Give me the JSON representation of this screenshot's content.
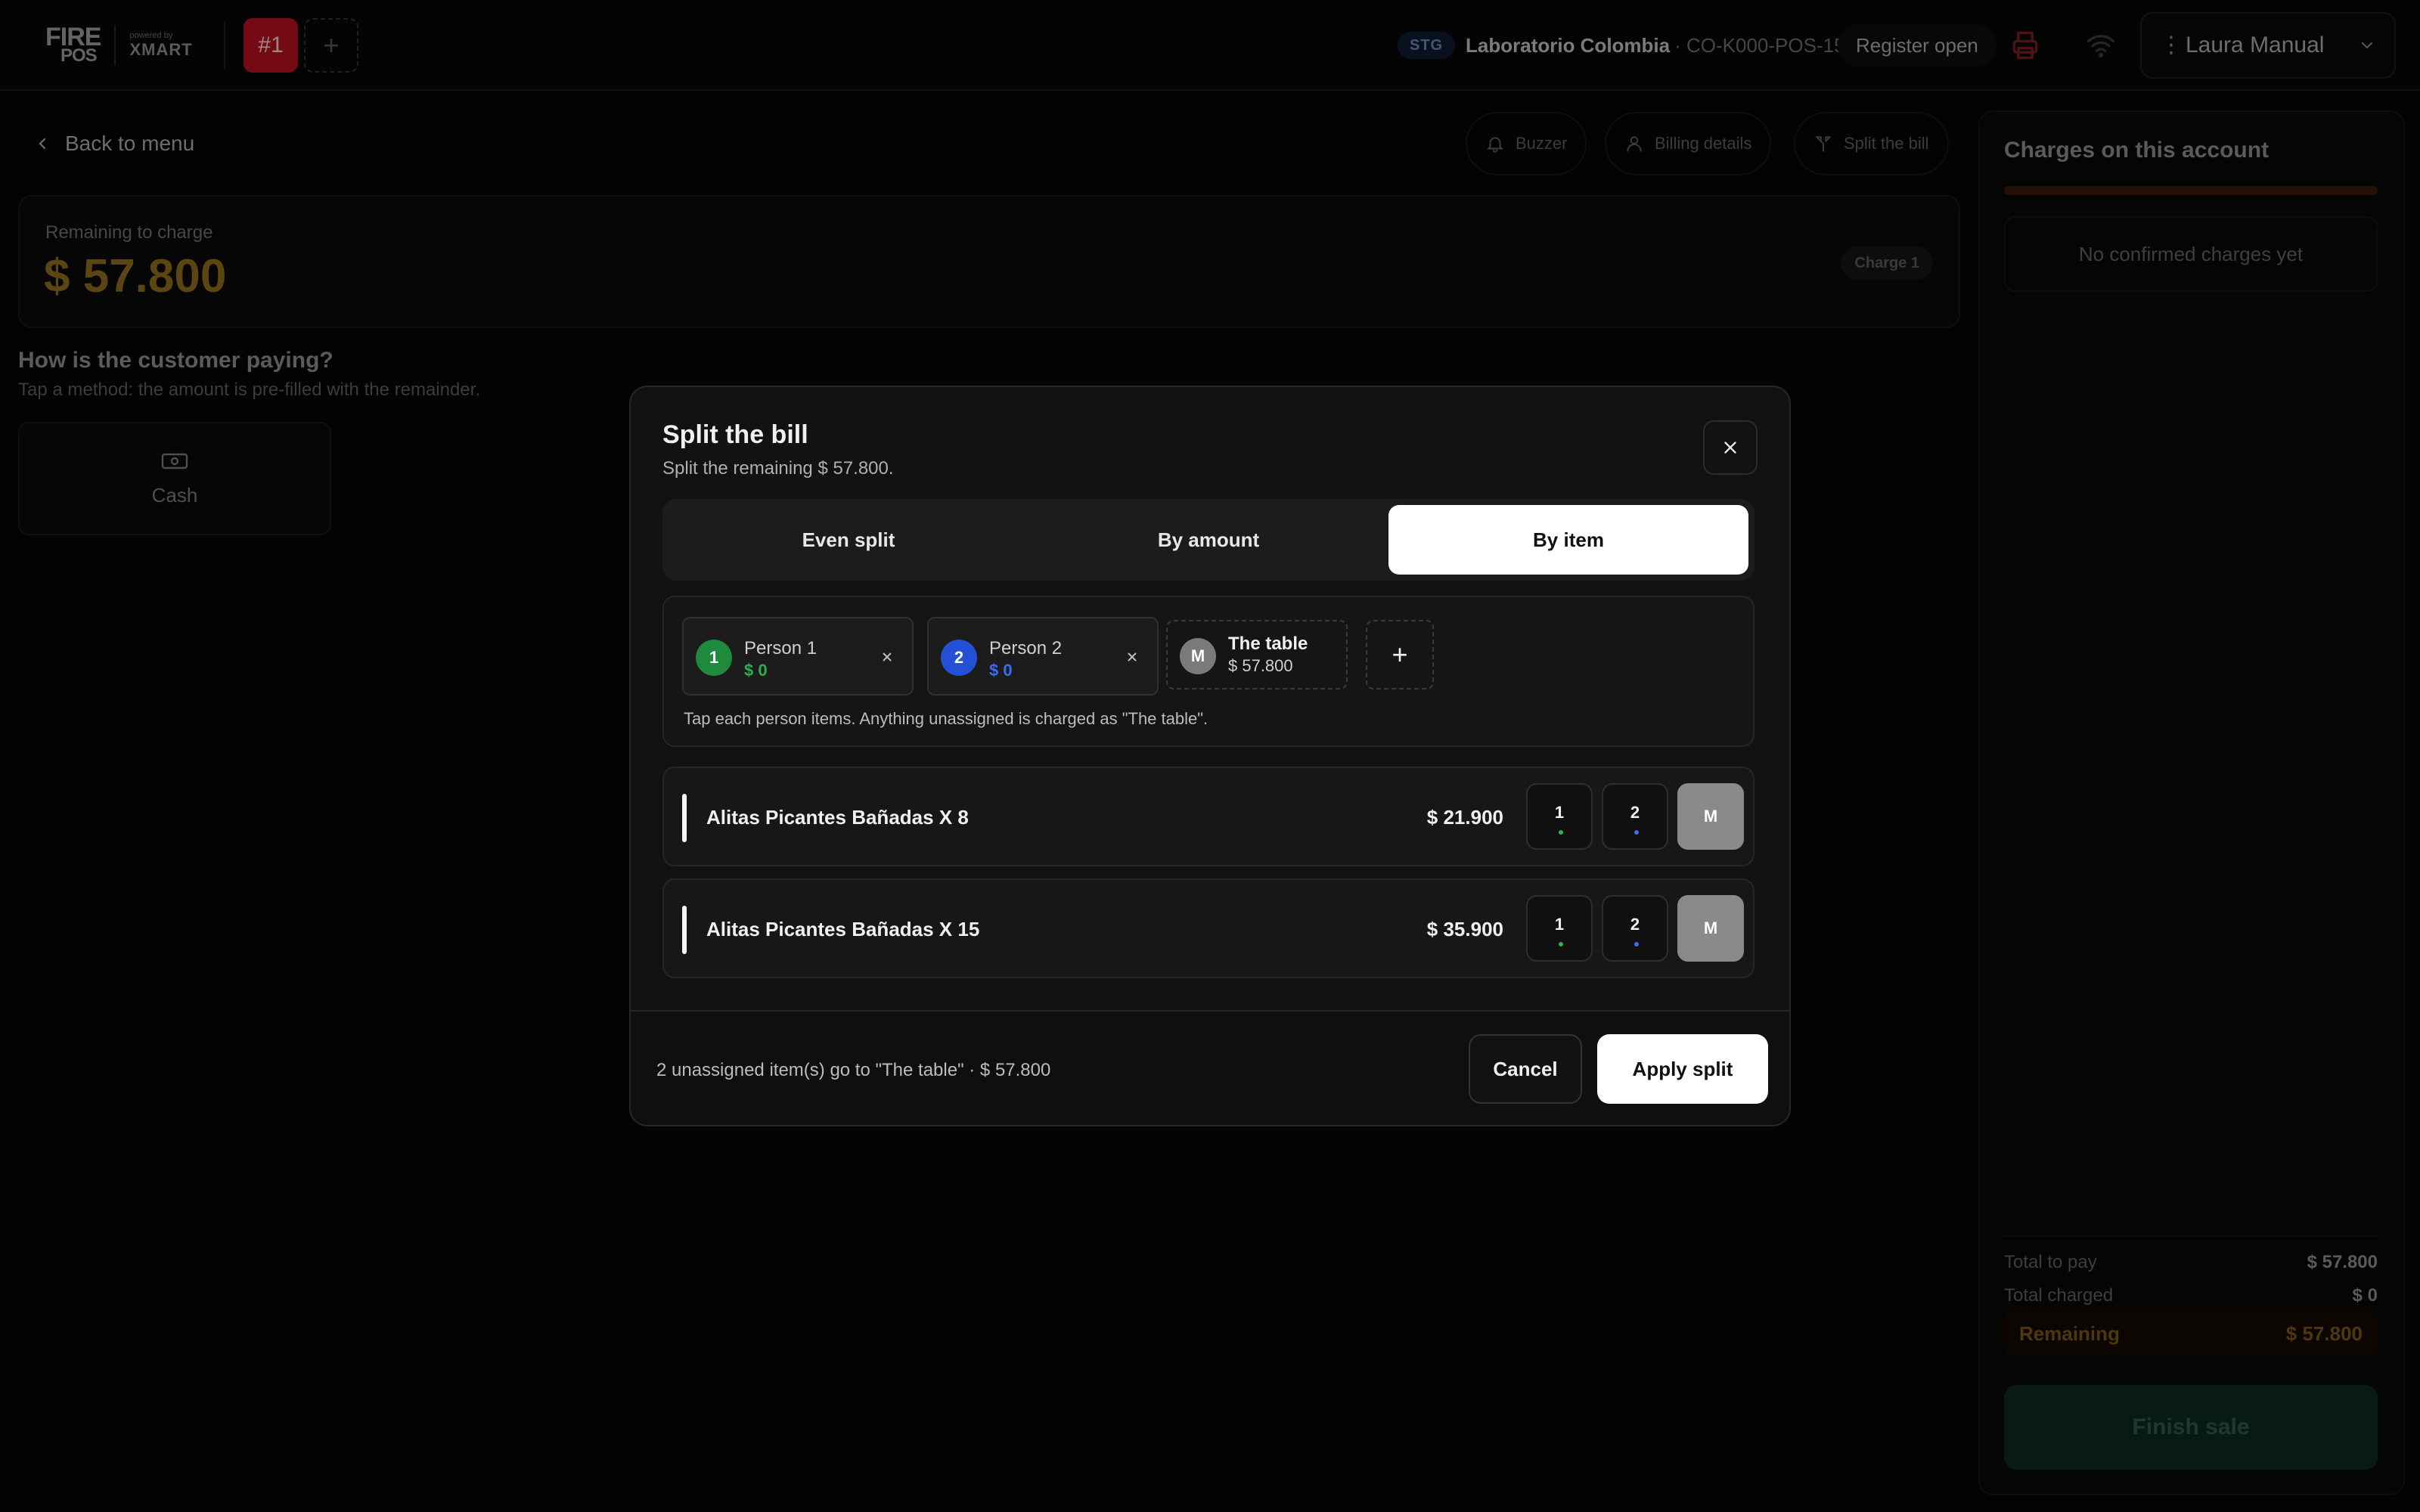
{
  "topbar": {
    "logo_main": "FIRE",
    "logo_sub": "POS",
    "logo_powered": "powered by",
    "logo_partner": "XMART",
    "active_tab": "#1",
    "add_tab": "+",
    "env_badge": "STG",
    "store_name": "Laboratorio Colombia",
    "store_code": "· CO-K000-POS-15",
    "register_status": "Register open",
    "user_name": "Laura Manual",
    "icons": [
      "printer-icon",
      "wifi-icon",
      "more-vertical-icon",
      "chevron-down-icon"
    ]
  },
  "main": {
    "back_label": "Back to menu",
    "actions": [
      {
        "label": "Buzzer",
        "icon": "bell-icon"
      },
      {
        "label": "Billing details",
        "icon": "user-icon"
      },
      {
        "label": "Split the bill",
        "icon": "split-icon"
      }
    ],
    "remaining_label": "Remaining to charge",
    "remaining_value": "$ 57.800",
    "charge_badge": "Charge 1",
    "paying_title": "How is the customer paying?",
    "paying_subtitle": "Tap a method: the amount is pre-filled with the remainder.",
    "methods": [
      {
        "label": "Cash",
        "icon": "cash-icon"
      }
    ]
  },
  "right_panel": {
    "title": "Charges on this account",
    "progress_fraction": 0.0,
    "empty_text": "No confirmed charges yet",
    "total_to_pay_label": "Total to pay",
    "total_to_pay_value": "$ 57.800",
    "total_charged_label": "Total charged",
    "total_charged_value": "$ 0",
    "remaining_label": "Remaining",
    "remaining_value": "$ 57.800",
    "finish_label": "Finish sale"
  },
  "modal": {
    "title": "Split the bill",
    "subtitle": "Split the remaining $ 57.800.",
    "tabs": [
      {
        "label": "Even split",
        "active": false
      },
      {
        "label": "By amount",
        "active": false
      },
      {
        "label": "By item",
        "active": true
      }
    ],
    "people": [
      {
        "badge": "1",
        "name": "Person 1",
        "amount": "$ 0",
        "color": "#1e8a3c",
        "amount_color": "#2bb04e"
      },
      {
        "badge": "2",
        "name": "Person 2",
        "amount": "$ 0",
        "color": "#2450d8",
        "amount_color": "#3b6ef0"
      }
    ],
    "table_chip": {
      "badge": "M",
      "name": "The table",
      "amount": "$ 57.800"
    },
    "add_person": "+",
    "hint": "Tap each person items. Anything unassigned is charged as \"The table\".",
    "items": [
      {
        "name": "Alitas Picantes Bañadas X 8",
        "price": "$ 21.900",
        "buttons": [
          "1",
          "2",
          "M"
        ]
      },
      {
        "name": "Alitas Picantes Bañadas X 15",
        "price": "$ 35.900",
        "buttons": [
          "1",
          "2",
          "M"
        ]
      }
    ],
    "footer_text": "2 unassigned item(s) go to \"The table\" · $ 57.800",
    "cancel_label": "Cancel",
    "apply_label": "Apply split"
  }
}
